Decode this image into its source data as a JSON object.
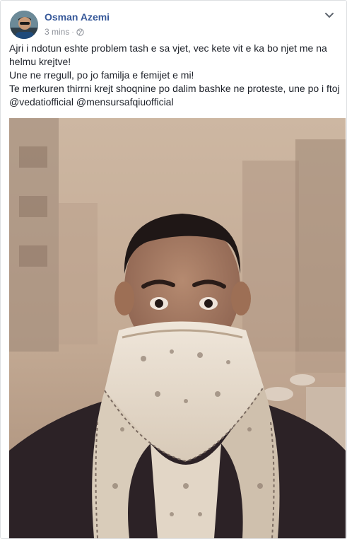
{
  "post": {
    "author_name": "Osman Azemi",
    "timestamp": "3 mins",
    "separator": "·",
    "privacy_icon": "globe-icon",
    "menu_icon": "chevron-down-icon",
    "text_lines": [
      "Ajri i ndotun eshte problem tash e sa vjet, vec kete vit e ka bo njet me na helmu krejtve!",
      "Une ne rregull, po jo familja e femijet e mi!",
      "Te merkuren thirrni krejt shoqnine po dalim bashke ne proteste, une po i ftoj @vedatiofficial @mensursafqiuofficial"
    ],
    "photo": "man-with-bandana-face-mask-in-smog",
    "colors": {
      "author_link": "#365899",
      "meta_text": "#90949c",
      "body_text": "#1d2129"
    }
  }
}
